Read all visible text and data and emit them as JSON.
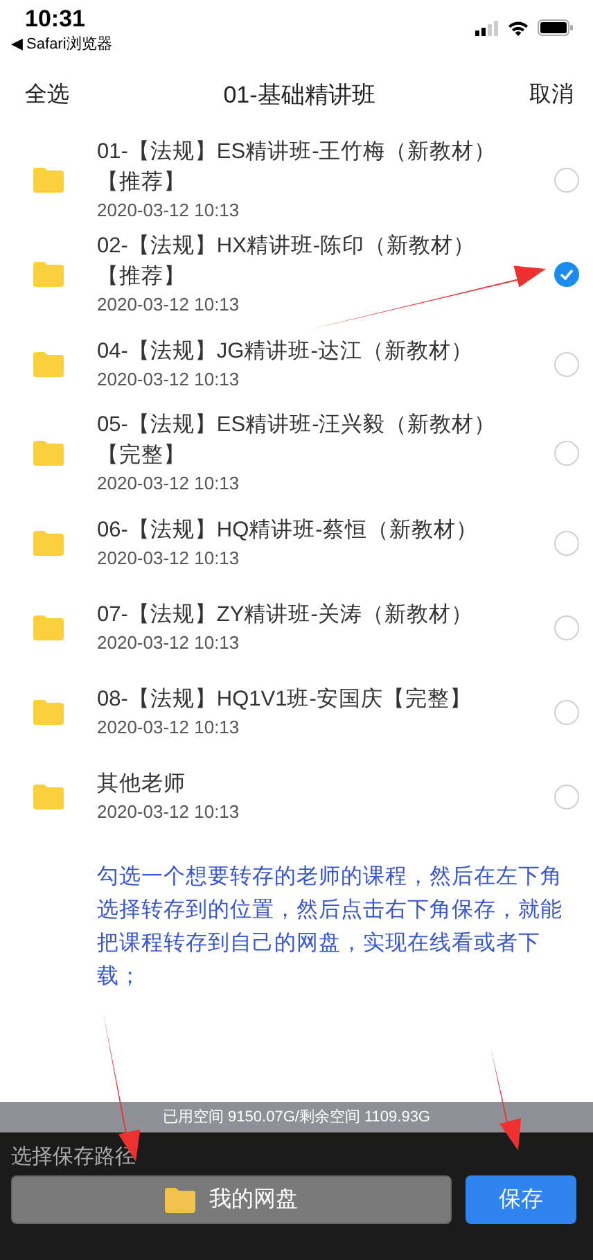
{
  "status_bar": {
    "time": "10:31",
    "back_app": "◀ Safari浏览器"
  },
  "nav": {
    "left": "全选",
    "title": "01-基础精讲班",
    "right": "取消"
  },
  "files": [
    {
      "name": "01-【法规】ES精讲班-王竹梅（新教材）【推荐】",
      "date": "2020-03-12 10:13",
      "selected": false
    },
    {
      "name": "02-【法规】HX精讲班-陈印（新教材）【推荐】",
      "date": "2020-03-12 10:13",
      "selected": true
    },
    {
      "name": "04-【法规】JG精讲班-达江（新教材）",
      "date": "2020-03-12 10:13",
      "selected": false
    },
    {
      "name": "05-【法规】ES精讲班-汪兴毅（新教材）【完整】",
      "date": "2020-03-12 10:13",
      "selected": false
    },
    {
      "name": "06-【法规】HQ精讲班-蔡恒（新教材）",
      "date": "2020-03-12 10:13",
      "selected": false
    },
    {
      "name": "07-【法规】ZY精讲班-关涛（新教材）",
      "date": "2020-03-12 10:13",
      "selected": false
    },
    {
      "name": "08-【法规】HQ1V1班-安国庆【完整】",
      "date": "2020-03-12 10:13",
      "selected": false
    },
    {
      "name": "其他老师",
      "date": "2020-03-12 10:13",
      "selected": false
    }
  ],
  "note": "勾选一个想要转存的老师的课程，然后在左下角选择转存到的位置，然后点击右下角保存，就能把课程转存到自己的网盘，实现在线看或者下载；",
  "storage": "已用空间 9150.07G/剩余空间 1109.93G",
  "save_panel": {
    "label": "选择保存路径",
    "path": "我的网盘",
    "save": "保存"
  }
}
